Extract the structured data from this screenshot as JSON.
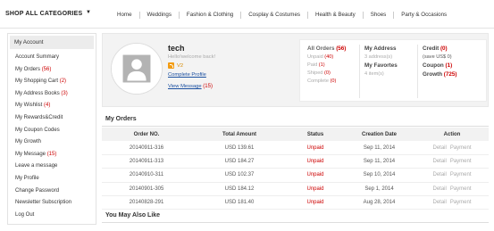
{
  "topbar": {
    "shop_all": "SHOP ALL CATEGORIES",
    "nav": [
      "Home",
      "Weddings",
      "Fashion & Clothing",
      "Cosplay & Costumes",
      "Health & Beauty",
      "Shoes",
      "Party & Occasions"
    ]
  },
  "sidebar": {
    "title": "My Account",
    "items": [
      {
        "label": "Account Summary",
        "count": ""
      },
      {
        "label": "My Orders",
        "count": "(56)"
      },
      {
        "label": "My Shopping Cart",
        "count": "(2)"
      },
      {
        "label": "My Address Books",
        "count": "(3)"
      },
      {
        "label": "My Wishlist",
        "count": "(4)"
      },
      {
        "label": "My Rewards&Credit",
        "count": ""
      },
      {
        "label": "My Coupon Codes",
        "count": ""
      },
      {
        "label": "My Growth",
        "count": ""
      },
      {
        "label": "My Message",
        "count": "(15)"
      },
      {
        "label": "Leave a message",
        "count": ""
      },
      {
        "label": "My Profile",
        "count": ""
      },
      {
        "label": "Change Password",
        "count": ""
      },
      {
        "label": "Newsletter Subscription",
        "count": ""
      },
      {
        "label": "Log Out",
        "count": ""
      }
    ]
  },
  "profile": {
    "username": "tech",
    "greeting": "Hello!welcome back!",
    "level": "V2",
    "complete_profile": "Complete Profile",
    "view_message": "View Message",
    "message_count": "(15)"
  },
  "stats": {
    "all_orders": "All Orders",
    "all_orders_count": "(56)",
    "unpaid": "Unpaid",
    "unpaid_count": "(40)",
    "paid": "Paid",
    "paid_count": "(1)",
    "shipped": "Shiped",
    "shipped_count": "(0)",
    "complete": "Complete",
    "complete_count": "(0)",
    "address_title": "My Address",
    "address_sub": "3 address(s)",
    "favorites_title": "My Favortes",
    "favorites_sub": "4 item(s)",
    "credit": "Credit",
    "credit_count": "(0)",
    "credit_sub": "(save US$ 0)",
    "coupon": "Coupon",
    "coupon_count": "(1)",
    "growth": "Growth",
    "growth_count": "(725)"
  },
  "orders": {
    "title": "My Orders",
    "headers": [
      "Order NO.",
      "Total Amount",
      "Status",
      "Creation Date",
      "Action"
    ],
    "rows": [
      {
        "no": "20140911-316",
        "amount": "USD 139.61",
        "status": "Unpaid",
        "date": "Sep 11, 2014",
        "detail": "Detail",
        "payment": "Payment"
      },
      {
        "no": "20140911-313",
        "amount": "USD 184.27",
        "status": "Unpaid",
        "date": "Sep 11, 2014",
        "detail": "Detail",
        "payment": "Payment"
      },
      {
        "no": "20140910-311",
        "amount": "USD 102.37",
        "status": "Unpaid",
        "date": "Sep 10, 2014",
        "detail": "Detail",
        "payment": "Payment"
      },
      {
        "no": "20140901-305",
        "amount": "USD 184.12",
        "status": "Unpaid",
        "date": "Sep 1, 2014",
        "detail": "Detail",
        "payment": "Payment"
      },
      {
        "no": "20140828-291",
        "amount": "USD 181.40",
        "status": "Unpaid",
        "date": "Aug 28, 2014",
        "detail": "Detail",
        "payment": "Payment"
      }
    ]
  },
  "also_like": {
    "title": "You May Also Like"
  },
  "colors": {
    "accent_red": "#cc0000",
    "link_blue": "#1a4fa0",
    "vip_orange": "#f39c12"
  },
  "icons": {
    "dropdown": "chevron-down-icon",
    "avatar": "user-silhouette-icon",
    "vip": "rss-icon"
  }
}
